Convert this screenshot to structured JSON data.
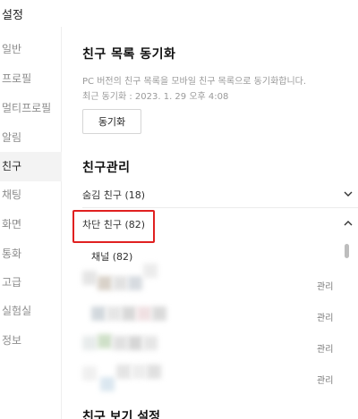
{
  "window": {
    "title": "설정"
  },
  "sidebar": {
    "items": [
      {
        "label": "일반"
      },
      {
        "label": "프로필"
      },
      {
        "label": "멀티프로필"
      },
      {
        "label": "알림"
      },
      {
        "label": "친구"
      },
      {
        "label": "채팅"
      },
      {
        "label": "화면"
      },
      {
        "label": "통화"
      },
      {
        "label": "고급"
      },
      {
        "label": "실험실"
      },
      {
        "label": "정보"
      }
    ],
    "active": "친구"
  },
  "sync": {
    "title": "친구 목록 동기화",
    "description": "PC 버전의 친구 목록을 모바일 친구 목록으로 동기화합니다.",
    "last_sync": "최근 동기화 : 2023. 1. 29 오후 4:08",
    "button_label": "동기화"
  },
  "manage": {
    "title": "친구관리",
    "hidden_friends": {
      "label": "숨김 친구 (18)",
      "chevron": "chevron-down-icon"
    },
    "blocked_friends": {
      "label": "차단 친구 (82)",
      "chevron": "chevron-up-icon"
    },
    "channel_label": "채널 (82)",
    "manage_label": "관리",
    "highlight_color": "#e02020"
  },
  "bottom_section": {
    "title": "친구 보기 설정"
  }
}
